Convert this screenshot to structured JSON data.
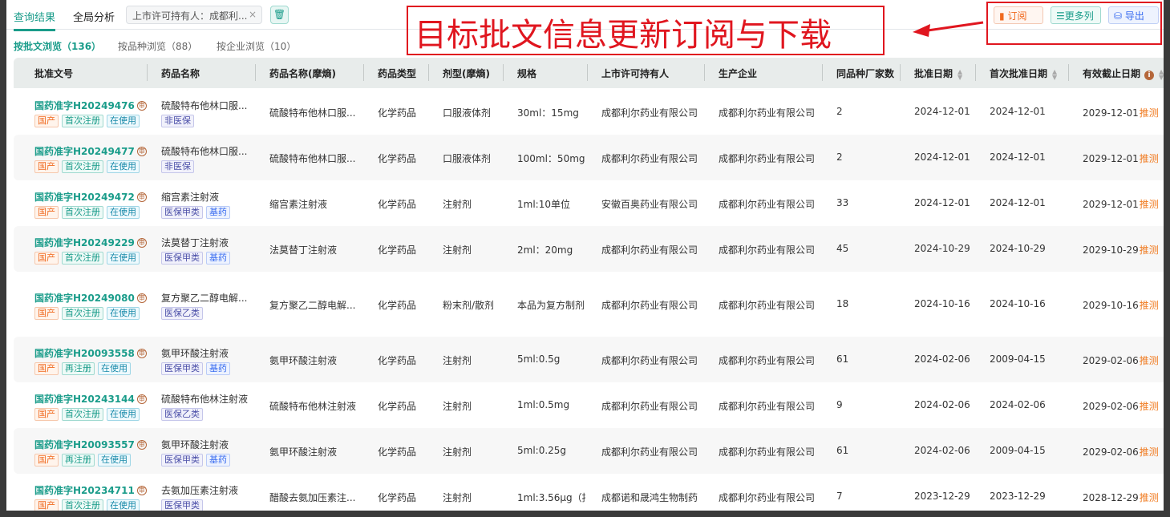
{
  "tabs": [
    "查询结果",
    "全局分析"
  ],
  "filter_chip": "上市许可持有人：成都利...",
  "filter_close": "×",
  "toolbar": {
    "subscribe": "订阅",
    "more_columns": "更多列",
    "export": "导出"
  },
  "subtabs": [
    "按批文浏览（136）",
    "按品种浏览（88）",
    "按企业浏览（10）"
  ],
  "annotation": "目标批文信息更新订阅与下载",
  "columns": [
    "批准文号",
    "药品名称",
    "药品名称(摩熵)",
    "药品类型",
    "剂型(摩熵)",
    "规格",
    "上市许可持有人",
    "生产企业",
    "同品种厂家数",
    "批准日期",
    "首次批准日期",
    "有效截止日期"
  ],
  "guess_label": "推测",
  "rows": [
    {
      "no": "国药准字H20249476",
      "tags": [
        "国产",
        "首次注册",
        "在使用"
      ],
      "name": "硫酸特布他林口服...",
      "ins": [
        "非医保"
      ],
      "name2": "硫酸特布他林口服...",
      "type": "化学药品",
      "form": "口服液体剂",
      "spec": "30ml：15mg",
      "holder": "成都利尔药业有限公司",
      "maker": "成都利尔药业有限公司",
      "count": "2",
      "date": "2024-12-01",
      "first": "2024-12-01",
      "expire": "2029-12-01"
    },
    {
      "no": "国药准字H20249477",
      "tags": [
        "国产",
        "首次注册",
        "在使用"
      ],
      "name": "硫酸特布他林口服...",
      "ins": [
        "非医保"
      ],
      "name2": "硫酸特布他林口服...",
      "type": "化学药品",
      "form": "口服液体剂",
      "spec": "100ml：50mg",
      "holder": "成都利尔药业有限公司",
      "maker": "成都利尔药业有限公司",
      "count": "2",
      "date": "2024-12-01",
      "first": "2024-12-01",
      "expire": "2029-12-01"
    },
    {
      "no": "国药准字H20249472",
      "tags": [
        "国产",
        "首次注册",
        "在使用"
      ],
      "name": "缩宫素注射液",
      "ins": [
        "医保甲类",
        "基药"
      ],
      "name2": "缩宫素注射液",
      "type": "化学药品",
      "form": "注射剂",
      "spec": "1ml:10单位",
      "holder": "安徽百奥药业有限公司",
      "maker": "成都利尔药业有限公司",
      "count": "33",
      "date": "2024-12-01",
      "first": "2024-12-01",
      "expire": "2029-12-01"
    },
    {
      "no": "国药准字H20249229",
      "tags": [
        "国产",
        "首次注册",
        "在使用"
      ],
      "name": "法莫替丁注射液",
      "ins": [
        "医保甲类",
        "基药"
      ],
      "name2": "法莫替丁注射液",
      "type": "化学药品",
      "form": "注射剂",
      "spec": "2ml：20mg",
      "holder": "成都利尔药业有限公司",
      "maker": "成都利尔药业有限公司",
      "count": "45",
      "date": "2024-10-29",
      "first": "2024-10-29",
      "expire": "2029-10-29"
    },
    {
      "no": "国药准字H20249080",
      "tags": [
        "国产",
        "首次注册",
        "在使用"
      ],
      "name": "复方聚乙二醇电解...",
      "ins": [
        "医保乙类"
      ],
      "name2": "复方聚乙二醇电解...",
      "type": "化学药品",
      "form": "粉末剂/散剂",
      "spec": "本品为复方制剂",
      "holder": "成都利尔药业有限公司",
      "maker": "成都利尔药业有限公司",
      "count": "18",
      "date": "2024-10-16",
      "first": "2024-10-16",
      "expire": "2029-10-16"
    },
    {
      "no": "国药准字H20093558",
      "tags": [
        "国产",
        "再注册",
        "在使用"
      ],
      "name": "氨甲环酸注射液",
      "ins": [
        "医保甲类",
        "基药"
      ],
      "name2": "氨甲环酸注射液",
      "type": "化学药品",
      "form": "注射剂",
      "spec": "5ml:0.5g",
      "holder": "成都利尔药业有限公司",
      "maker": "成都利尔药业有限公司",
      "count": "61",
      "date": "2024-02-06",
      "first": "2009-04-15",
      "expire": "2029-02-06"
    },
    {
      "no": "国药准字H20243144",
      "tags": [
        "国产",
        "首次注册",
        "在使用"
      ],
      "name": "硫酸特布他林注射液",
      "ins": [
        "医保乙类"
      ],
      "name2": "硫酸特布他林注射液",
      "type": "化学药品",
      "form": "注射剂",
      "spec": "1ml:0.5mg",
      "holder": "成都利尔药业有限公司",
      "maker": "成都利尔药业有限公司",
      "count": "9",
      "date": "2024-02-06",
      "first": "2024-02-06",
      "expire": "2029-02-06"
    },
    {
      "no": "国药准字H20093557",
      "tags": [
        "国产",
        "再注册",
        "在使用"
      ],
      "name": "氨甲环酸注射液",
      "ins": [
        "医保甲类",
        "基药"
      ],
      "name2": "氨甲环酸注射液",
      "type": "化学药品",
      "form": "注射剂",
      "spec": "5ml:0.25g",
      "holder": "成都利尔药业有限公司",
      "maker": "成都利尔药业有限公司",
      "count": "61",
      "date": "2024-02-06",
      "first": "2009-04-15",
      "expire": "2029-02-06"
    },
    {
      "no": "国药准字H20234711",
      "tags": [
        "国产",
        "首次注册",
        "在使用"
      ],
      "name": "去氨加压素注射液",
      "ins": [
        "医保甲类"
      ],
      "name2": "醋酸去氨加压素注...",
      "type": "化学药品",
      "form": "注射剂",
      "spec": "1ml:3.56μg（按",
      "holder": "成都诺和晟鸿生物制药",
      "maker": "成都利尔药业有限公司",
      "count": "7",
      "date": "2023-12-29",
      "first": "2023-12-29",
      "expire": "2028-12-29"
    }
  ]
}
